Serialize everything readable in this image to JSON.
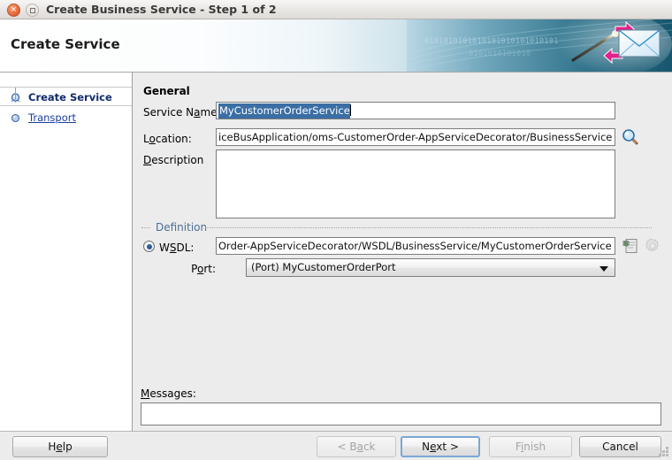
{
  "window": {
    "title": "Create Business Service - Step 1 of 2",
    "close_icon": "close-icon",
    "maximize_icon": "maximize-icon"
  },
  "header": {
    "title": "Create Service",
    "banner_binary_1": "0101010101010101010101010101",
    "banner_binary_2": "0101010101010",
    "banner_icons": [
      "envelope-icon",
      "arrow-right-icon",
      "arrow-left-icon",
      "wand-icon"
    ]
  },
  "sidebar": {
    "items": [
      {
        "label": "Create Service",
        "selected": true,
        "icon": "tree-node-selected-icon"
      },
      {
        "label": "Transport",
        "selected": false,
        "icon": "tree-node-icon"
      }
    ]
  },
  "main": {
    "general_title": "General",
    "service_name": {
      "label_pre": "Service N",
      "label_mn": "a",
      "label_post": "me:",
      "value": "MyCustomerOrderService",
      "selected": true
    },
    "location": {
      "label_pre": "L",
      "label_mn": "o",
      "label_post": "cation:",
      "value": "iceBusApplication/oms-CustomerOrder-AppServiceDecorator/BusinessService",
      "browse_icon": "magnifier-icon"
    },
    "description": {
      "label_mn": "D",
      "label_post": "escription",
      "value": ""
    },
    "definition": {
      "title": "Definition",
      "wsdl": {
        "label_pre": "W",
        "label_mn": "S",
        "label_post": "DL:",
        "radio_selected": true,
        "value": "Order-AppServiceDecorator/WSDL/BusinessService/MyCustomerOrderService",
        "browse_icon": "wsdl-browse-icon",
        "settings_icon": "gear-icon"
      },
      "port": {
        "label_pre": "P",
        "label_mn": "o",
        "label_post": "rt:",
        "value": "(Port) MyCustomerOrderPort",
        "arrow_icon": "chevron-down-icon"
      }
    },
    "messages": {
      "label_mn": "M",
      "label_post": "essages:",
      "value": ""
    }
  },
  "footer": {
    "help": {
      "label_pre": "H",
      "label_mn": "e",
      "label_post": "lp",
      "disabled": false
    },
    "back": {
      "label_pre": "< B",
      "label_mn": "a",
      "label_post": "ck",
      "disabled": true
    },
    "next": {
      "label_pre": "N",
      "label_mn": "e",
      "label_post": "xt >",
      "disabled": false,
      "focused": true
    },
    "finish": {
      "label_pre": "F",
      "label_mn": "i",
      "label_post": "nish",
      "disabled": true
    },
    "cancel": {
      "label": "Cancel",
      "disabled": false
    }
  },
  "colors": {
    "banner_dark": "#1d5c74",
    "selection_blue": "#3a6ea5",
    "link_blue": "#1a3fa0",
    "group_label": "#4b6f94",
    "accent_pink": "#e3208b",
    "close_orange": "#e8693a"
  }
}
